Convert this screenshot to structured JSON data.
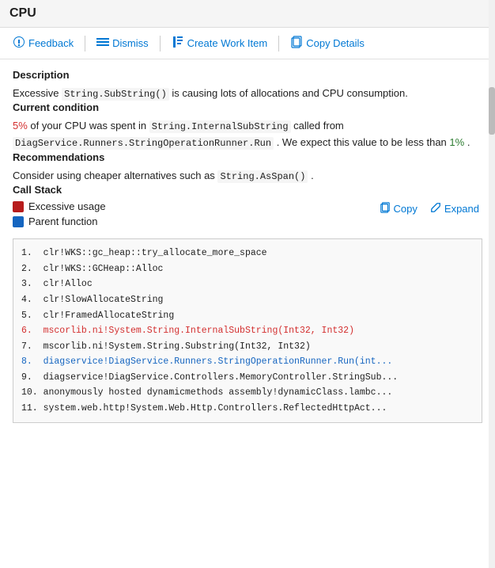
{
  "titlebar": {
    "text": "CPU"
  },
  "toolbar": {
    "buttons": [
      {
        "id": "feedback",
        "icon": "👤",
        "label": "Feedback"
      },
      {
        "id": "dismiss",
        "icon": "☰",
        "label": "Dismiss"
      },
      {
        "id": "create-work-item",
        "icon": "📖",
        "label": "Create Work Item"
      },
      {
        "id": "copy-details",
        "icon": "📄",
        "label": "Copy Details"
      }
    ]
  },
  "sections": {
    "description": {
      "title": "Description",
      "text_before": "Excessive",
      "code1": "String.SubString()",
      "text_after": "is causing lots of allocations and CPU consumption."
    },
    "current_condition": {
      "title": "Current condition",
      "percent": "5%",
      "text1": "of your CPU was spent in",
      "code1": "String.InternalSubString",
      "text2": "called from",
      "code2": "DiagService.Runners.StringOperationRunner.Run",
      "text3": ". We expect this value to be less than",
      "percent2": "1%",
      "text4": "."
    },
    "recommendations": {
      "title": "Recommendations",
      "text_before": "Consider using cheaper alternatives such as",
      "code1": "String.AsSpan()",
      "text_after": "."
    },
    "callstack": {
      "title": "Call Stack",
      "legend": [
        {
          "color": "red",
          "label": "Excessive usage"
        },
        {
          "color": "blue",
          "label": "Parent function"
        }
      ],
      "actions": [
        {
          "id": "copy",
          "icon": "⧉",
          "label": "Copy"
        },
        {
          "id": "expand",
          "icon": "⤢",
          "label": "Expand"
        }
      ],
      "lines": [
        {
          "num": "1.",
          "text": "clr!WKS::gc_heap::try_allocate_more_space",
          "style": "normal"
        },
        {
          "num": "2.",
          "text": "clr!WKS::GCHeap::Alloc",
          "style": "normal"
        },
        {
          "num": "3.",
          "text": "clr!Alloc",
          "style": "normal"
        },
        {
          "num": "4.",
          "text": "clr!SlowAllocateString",
          "style": "normal"
        },
        {
          "num": "5.",
          "text": "clr!FramedAllocateString",
          "style": "normal"
        },
        {
          "num": "6.",
          "text": "mscorlib.ni!System.String.InternalSubString(Int32, Int32)",
          "style": "red"
        },
        {
          "num": "7.",
          "text": "mscorlib.ni!System.String.Substring(Int32, Int32)",
          "style": "normal"
        },
        {
          "num": "8.",
          "text": "diagservice!DiagService.Runners.StringOperationRunner.Run(int...",
          "style": "blue"
        },
        {
          "num": "9.",
          "text": "diagservice!DiagService.Controllers.MemoryController.StringSub...",
          "style": "normal"
        },
        {
          "num": "10.",
          "text": "anonymously hosted dynamicmethods assembly!dynamicClass.lambc...",
          "style": "normal"
        },
        {
          "num": "11.",
          "text": "system.web.http!System.Web.Http.Controllers.ReflectedHttpAct...",
          "style": "normal"
        }
      ]
    }
  }
}
